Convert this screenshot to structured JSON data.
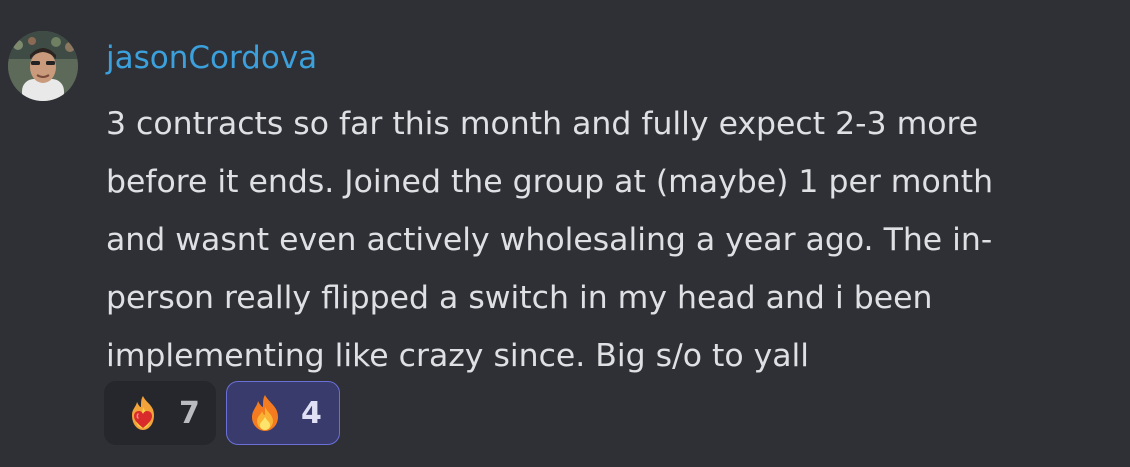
{
  "message": {
    "author": "jasonCordova",
    "avatar_icon": "user-avatar",
    "content_lines": [
      "3 contracts so far this month and fully expect 2-3 more",
      "before it ends. Joined the group at (maybe) 1 per month",
      "and wasnt even actively wholesaling a year ago. The in-",
      "person really flipped a switch in my head and i been",
      "implementing like crazy since. Big s/o to yall"
    ]
  },
  "reactions": [
    {
      "icon": "fire-heart-icon",
      "count": "7",
      "active": false
    },
    {
      "icon": "fire-icon",
      "count": "4",
      "active": true
    }
  ],
  "colors": {
    "background": "#2f3036",
    "username": "#3ba0db",
    "text": "#dfe0e3",
    "reaction_bg": "#26272c",
    "reaction_active_bg": "#383b6b",
    "reaction_active_border": "#6a70d8"
  }
}
